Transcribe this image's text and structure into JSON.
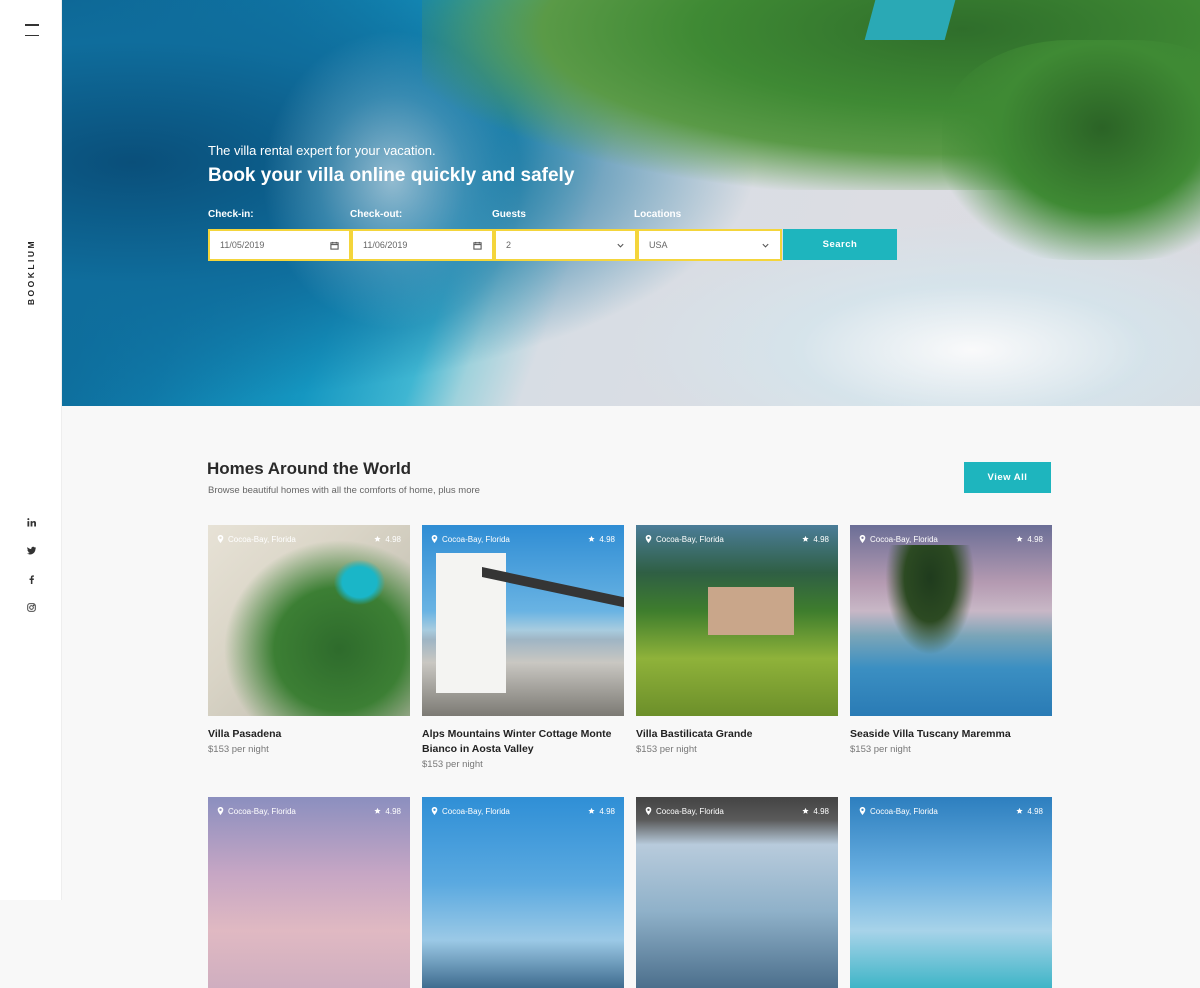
{
  "sidebar": {
    "brand": "BOOKLIUM",
    "social": [
      "linkedin-icon",
      "twitter-icon",
      "facebook-icon",
      "instagram-icon"
    ]
  },
  "hero": {
    "subtitle": "The villa rental expert for your vacation.",
    "title": "Book your villa online quickly and safely"
  },
  "search_form": {
    "checkin_label": "Check-in:",
    "checkin_value": "11/05/2019",
    "checkout_label": "Check-out:",
    "checkout_value": "11/06/2019",
    "guests_label": "Guests",
    "guests_value": "2",
    "locations_label": "Locations",
    "locations_value": "USA",
    "search_label": "Search"
  },
  "homes": {
    "title": "Homes Around the World",
    "subtitle": "Browse beautiful homes with all the comforts of home, plus more",
    "view_all_label": "View All",
    "cards": [
      {
        "location": "Cocoa-Bay,  Florida",
        "rating": "4.98",
        "name": "Villa Pasadena",
        "price": "$153 per night"
      },
      {
        "location": "Cocoa-Bay,  Florida",
        "rating": "4.98",
        "name": "Alps Mountains Winter Cottage Monte Bianco in Aosta Valley",
        "price": "$153 per night"
      },
      {
        "location": "Cocoa-Bay,  Florida",
        "rating": "4.98",
        "name": "Villa Bastilicata Grande",
        "price": "$153 per night"
      },
      {
        "location": "Cocoa-Bay,  Florida",
        "rating": "4.98",
        "name": "Seaside Villa Tuscany Maremma",
        "price": "$153 per night"
      },
      {
        "location": "Cocoa-Bay,  Florida",
        "rating": "4.98"
      },
      {
        "location": "Cocoa-Bay,  Florida",
        "rating": "4.98"
      },
      {
        "location": "Cocoa-Bay,  Florida",
        "rating": "4.98"
      },
      {
        "location": "Cocoa-Bay,  Florida",
        "rating": "4.98"
      }
    ]
  },
  "colors": {
    "accent": "#1eb5be",
    "field_border": "#f4d53b"
  }
}
